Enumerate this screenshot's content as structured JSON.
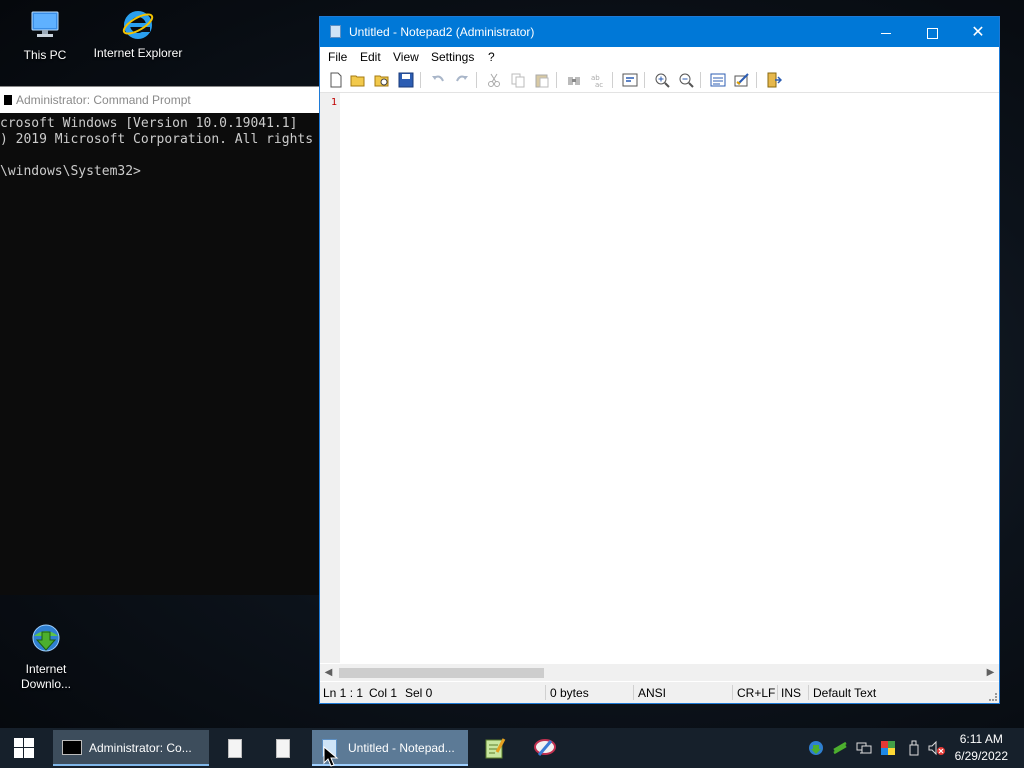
{
  "desktop": {
    "icons": [
      {
        "label": "This PC"
      },
      {
        "label": "Internet Explorer"
      },
      {
        "label": "Internet Downlo..."
      }
    ]
  },
  "cmd": {
    "title": "Administrator: Command Prompt",
    "lines": [
      "crosoft Windows [Version 10.0.19041.1]",
      ") 2019 Microsoft Corporation. All rights",
      "",
      "\\windows\\System32>"
    ]
  },
  "notepad": {
    "title": "Untitled - Notepad2 (Administrator)",
    "menu": [
      "File",
      "Edit",
      "View",
      "Settings",
      "?"
    ],
    "line_number": "1",
    "status": {
      "position": "Ln 1 : 1",
      "col": "Col 1",
      "sel": "Sel 0",
      "size": "0 bytes",
      "encoding": "ANSI",
      "eol": "CR+LF",
      "mode": "INS",
      "scheme": "Default Text"
    }
  },
  "taskbar": {
    "cmd_button": "Administrator: Co...",
    "notepad_button": "Untitled - Notepad...",
    "time": "6:11 AM",
    "date": "6/29/2022"
  },
  "colors": {
    "accent": "#0078d7",
    "taskbar": "#16202b",
    "line_number": "#c00000"
  }
}
